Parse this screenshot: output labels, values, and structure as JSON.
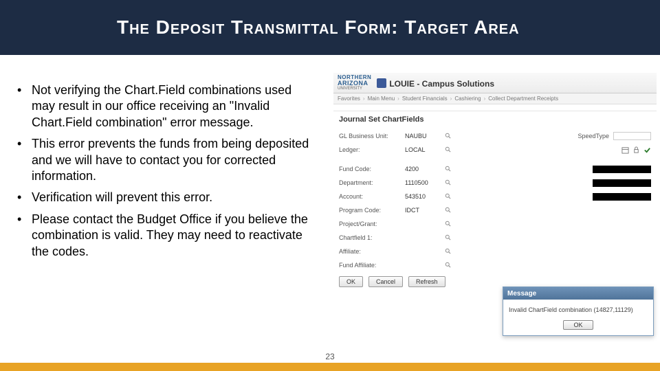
{
  "title": "The Deposit Transmittal Form: Target Area",
  "bullets": [
    "Not verifying the Chart.Field combinations used may result in our office receiving an \"Invalid Chart.Field combination\" error message.",
    "This error prevents the funds from being deposited and we will have to contact you for corrected information.",
    "Verification will prevent this error.",
    "Please contact the Budget Office if you believe the combination is valid.  They may need to reactivate the codes."
  ],
  "page_number": "23",
  "app": {
    "logo": {
      "line1": "NORTHERN",
      "line2": "ARIZONA",
      "line3": "UNIVERSITY"
    },
    "title": "LOUIE - Campus Solutions",
    "breadcrumb": [
      "Favorites",
      "Main Menu",
      "Student Financials",
      "Cashiering",
      "Collect Department Receipts"
    ],
    "form_title": "Journal Set ChartFields",
    "top_row": {
      "bu_label": "GL Business Unit:",
      "bu_value": "NAUBU",
      "speed_label": "SpeedType"
    },
    "ledger_row": {
      "label": "Ledger:",
      "value": "LOCAL"
    },
    "fields": [
      {
        "label": "Fund Code:",
        "value": "4200",
        "redacted": true
      },
      {
        "label": "Department:",
        "value": "1110500",
        "redacted": true
      },
      {
        "label": "Account:",
        "value": "543510",
        "redacted": true
      },
      {
        "label": "Program Code:",
        "value": "IDCT",
        "redacted": false
      },
      {
        "label": "Project/Grant:",
        "value": "",
        "redacted": false
      },
      {
        "label": "Chartfield 1:",
        "value": "",
        "redacted": false
      },
      {
        "label": "Affiliate:",
        "value": "",
        "redacted": false
      },
      {
        "label": "Fund Affiliate:",
        "value": "",
        "redacted": false
      }
    ],
    "buttons": {
      "ok": "OK",
      "cancel": "Cancel",
      "refresh": "Refresh"
    }
  },
  "dialog": {
    "title": "Message",
    "body": "Invalid ChartField combination (14827,11129)",
    "ok": "OK"
  }
}
